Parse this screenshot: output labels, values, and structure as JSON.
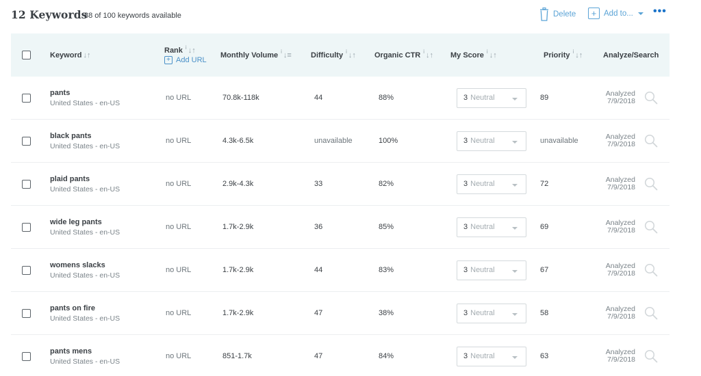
{
  "header": {
    "title": "12 Keywords",
    "subtitle": "88 of 100 keywords available",
    "delete_label": "Delete",
    "addto_label": "Add to...",
    "more_label": "•••"
  },
  "columns": {
    "keyword": "Keyword",
    "rank": "Rank",
    "add_url": "Add URL",
    "volume": "Monthly Volume",
    "difficulty": "Difficulty",
    "ctr": "Organic CTR",
    "score": "My Score",
    "priority": "Priority",
    "analyze": "Analyze/Search",
    "info_glyph": "i",
    "sort_glyph": "↓↑",
    "sort_active_glyph": "↓≡"
  },
  "rows": [
    {
      "keyword": "pants",
      "location": "United States - en-US",
      "rank": "no URL",
      "volume": "70.8k-118k",
      "difficulty": "44",
      "ctr": "88%",
      "score_num": "3",
      "score_label": "Neutral",
      "priority": "89",
      "analyzed_label": "Analyzed",
      "analyzed_date": "7/9/2018"
    },
    {
      "keyword": "black pants",
      "location": "United States - en-US",
      "rank": "no URL",
      "volume": "4.3k-6.5k",
      "difficulty": "unavailable",
      "ctr": "100%",
      "score_num": "3",
      "score_label": "Neutral",
      "priority": "unavailable",
      "analyzed_label": "Analyzed",
      "analyzed_date": "7/9/2018"
    },
    {
      "keyword": "plaid pants",
      "location": "United States - en-US",
      "rank": "no URL",
      "volume": "2.9k-4.3k",
      "difficulty": "33",
      "ctr": "82%",
      "score_num": "3",
      "score_label": "Neutral",
      "priority": "72",
      "analyzed_label": "Analyzed",
      "analyzed_date": "7/9/2018"
    },
    {
      "keyword": "wide leg pants",
      "location": "United States - en-US",
      "rank": "no URL",
      "volume": "1.7k-2.9k",
      "difficulty": "36",
      "ctr": "85%",
      "score_num": "3",
      "score_label": "Neutral",
      "priority": "69",
      "analyzed_label": "Analyzed",
      "analyzed_date": "7/9/2018"
    },
    {
      "keyword": "womens slacks",
      "location": "United States - en-US",
      "rank": "no URL",
      "volume": "1.7k-2.9k",
      "difficulty": "44",
      "ctr": "83%",
      "score_num": "3",
      "score_label": "Neutral",
      "priority": "67",
      "analyzed_label": "Analyzed",
      "analyzed_date": "7/9/2018"
    },
    {
      "keyword": "pants on fire",
      "location": "United States - en-US",
      "rank": "no URL",
      "volume": "1.7k-2.9k",
      "difficulty": "47",
      "ctr": "38%",
      "score_num": "3",
      "score_label": "Neutral",
      "priority": "58",
      "analyzed_label": "Analyzed",
      "analyzed_date": "7/9/2018"
    },
    {
      "keyword": "pants mens",
      "location": "United States - en-US",
      "rank": "no URL",
      "volume": "851-1.7k",
      "difficulty": "47",
      "ctr": "84%",
      "score_num": "3",
      "score_label": "Neutral",
      "priority": "63",
      "analyzed_label": "Analyzed",
      "analyzed_date": "7/9/2018"
    }
  ],
  "colors": {
    "accent": "#5aa3d6",
    "header_bg": "#eef6f7",
    "text": "#3a3f44",
    "muted": "#7a8389"
  },
  "icons": {
    "delete": "trash-icon",
    "add": "plus-square-icon",
    "more": "more-dots-icon",
    "search": "search-icon"
  }
}
